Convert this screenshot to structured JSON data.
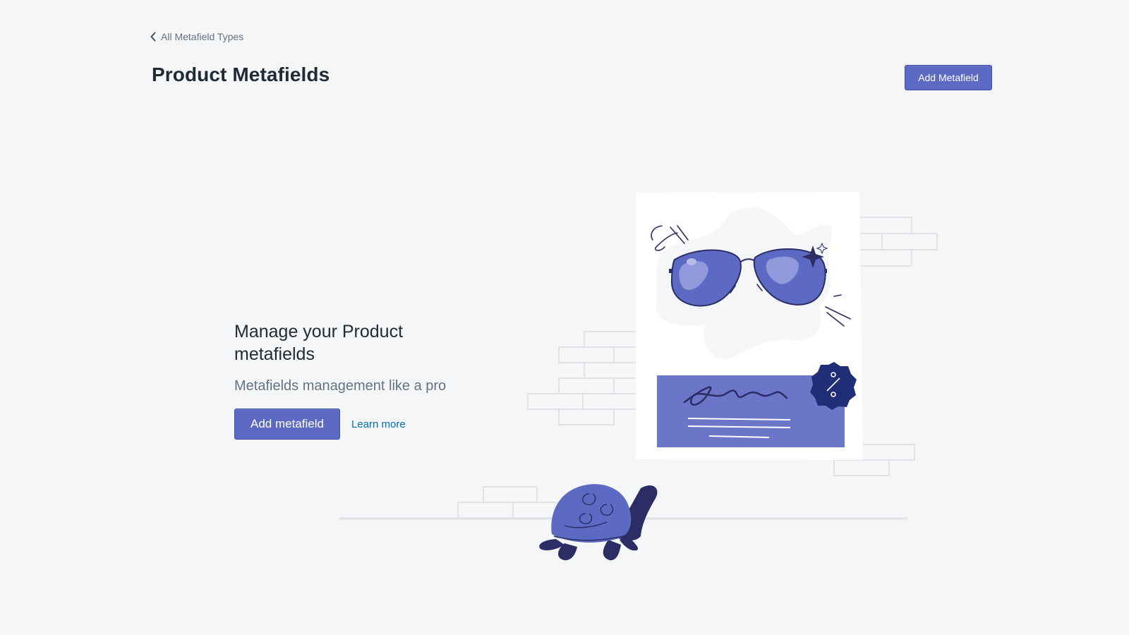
{
  "breadcrumb": {
    "label": "All Metafield Types",
    "icon": "chevron-left-icon"
  },
  "page": {
    "title": "Product Metafields"
  },
  "header_actions": {
    "primary_label": "Add Metafield"
  },
  "empty_state": {
    "heading": "Manage your Product metafields",
    "subheading": "Metafields management like a pro",
    "primary_action_label": "Add metafield",
    "secondary_action_label": "Learn more",
    "illustration": "empty-state-illustration"
  },
  "colors": {
    "background": "#f4f6f8",
    "primary": "#5c6ac4",
    "link": "#006fbb",
    "text": "#212b36",
    "subdued": "#637381"
  }
}
